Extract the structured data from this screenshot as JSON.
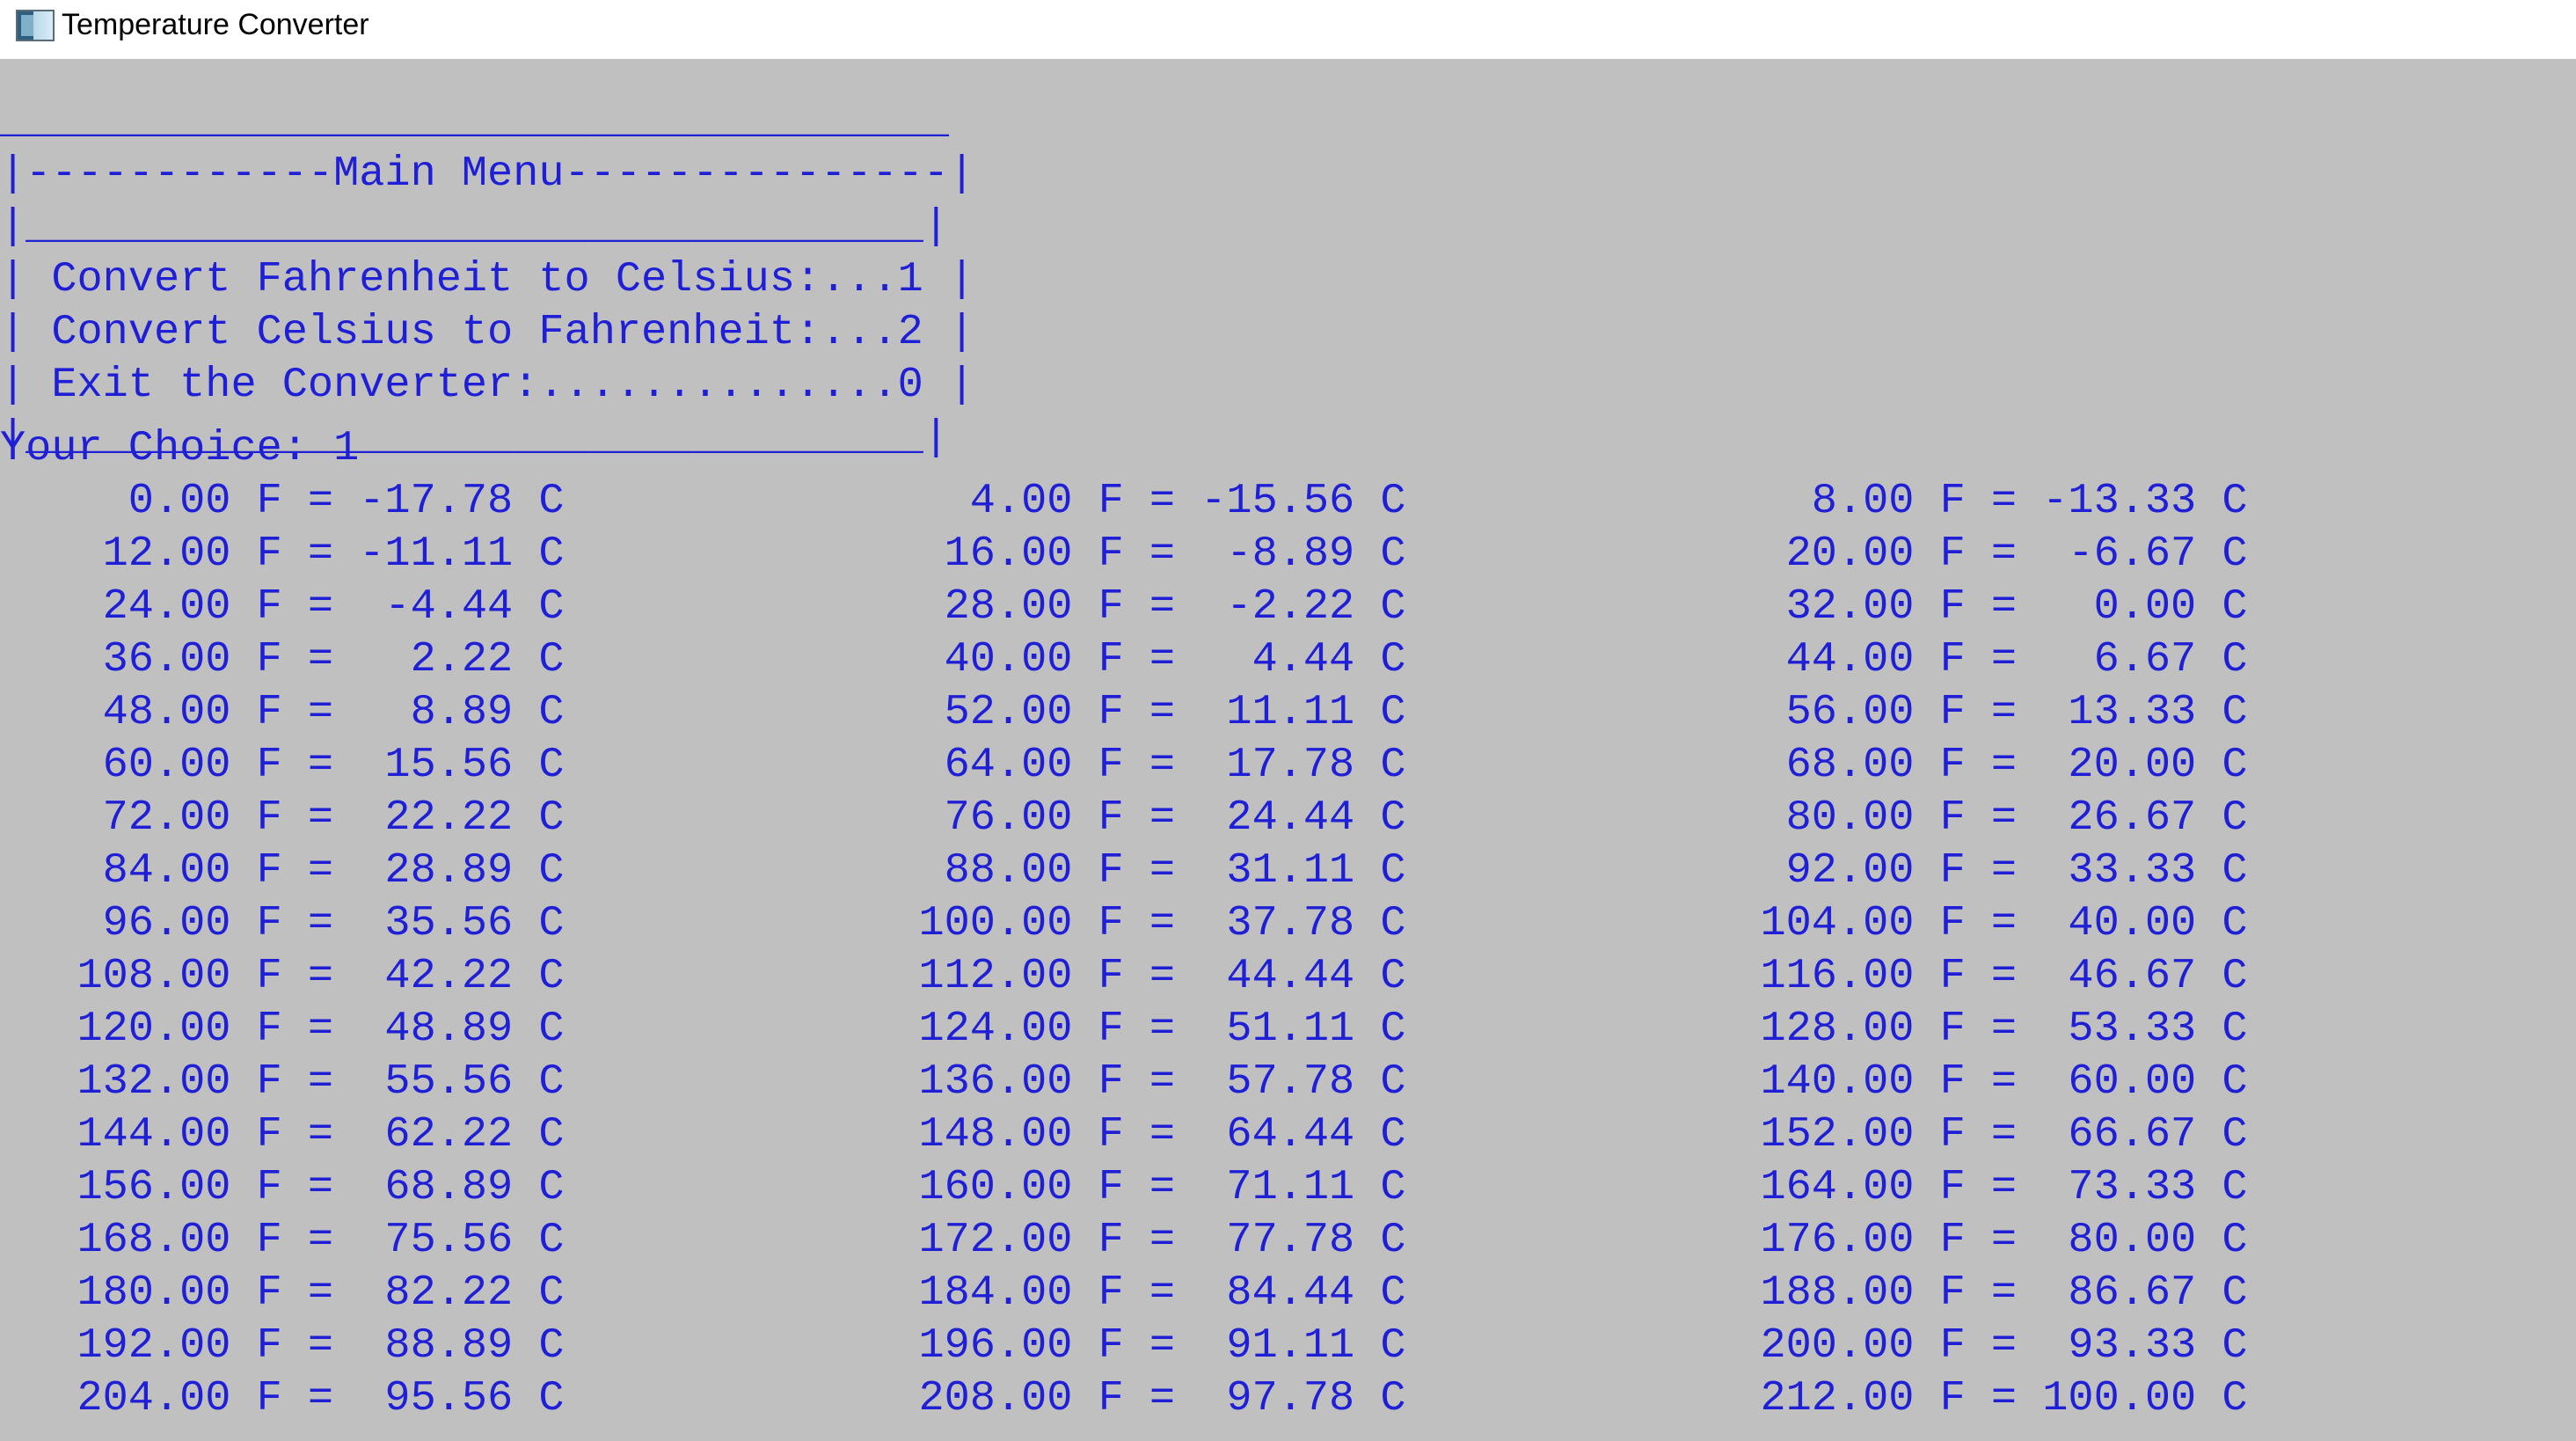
{
  "window": {
    "title": "Temperature Converter",
    "icon": "console-app-icon"
  },
  "colors": {
    "console_background": "#c0c0c0",
    "console_text": "#1f1fd6",
    "titlebar_background": "#ffffff"
  },
  "menu": {
    "lines": [
      "_____________________________________",
      "|------------Main Menu---------------|",
      "|___________________________________|",
      "| Convert Fahrenheit to Celsius:...1 |",
      "| Convert Celsius to Fahrenheit:...2 |",
      "| Exit the Converter:..............0 |",
      "|___________________________________|"
    ]
  },
  "prompt": {
    "text": "Your Choice: 1"
  },
  "table": {
    "rows": [
      [
        "     0.00 F = -17.78 C",
        "     4.00 F = -15.56 C",
        "     8.00 F = -13.33 C"
      ],
      [
        "    12.00 F = -11.11 C",
        "    16.00 F =  -8.89 C",
        "    20.00 F =  -6.67 C"
      ],
      [
        "    24.00 F =  -4.44 C",
        "    28.00 F =  -2.22 C",
        "    32.00 F =   0.00 C"
      ],
      [
        "    36.00 F =   2.22 C",
        "    40.00 F =   4.44 C",
        "    44.00 F =   6.67 C"
      ],
      [
        "    48.00 F =   8.89 C",
        "    52.00 F =  11.11 C",
        "    56.00 F =  13.33 C"
      ],
      [
        "    60.00 F =  15.56 C",
        "    64.00 F =  17.78 C",
        "    68.00 F =  20.00 C"
      ],
      [
        "    72.00 F =  22.22 C",
        "    76.00 F =  24.44 C",
        "    80.00 F =  26.67 C"
      ],
      [
        "    84.00 F =  28.89 C",
        "    88.00 F =  31.11 C",
        "    92.00 F =  33.33 C"
      ],
      [
        "    96.00 F =  35.56 C",
        "   100.00 F =  37.78 C",
        "   104.00 F =  40.00 C"
      ],
      [
        "   108.00 F =  42.22 C",
        "   112.00 F =  44.44 C",
        "   116.00 F =  46.67 C"
      ],
      [
        "   120.00 F =  48.89 C",
        "   124.00 F =  51.11 C",
        "   128.00 F =  53.33 C"
      ],
      [
        "   132.00 F =  55.56 C",
        "   136.00 F =  57.78 C",
        "   140.00 F =  60.00 C"
      ],
      [
        "   144.00 F =  62.22 C",
        "   148.00 F =  64.44 C",
        "   152.00 F =  66.67 C"
      ],
      [
        "   156.00 F =  68.89 C",
        "   160.00 F =  71.11 C",
        "   164.00 F =  73.33 C"
      ],
      [
        "   168.00 F =  75.56 C",
        "   172.00 F =  77.78 C",
        "   176.00 F =  80.00 C"
      ],
      [
        "   180.00 F =  82.22 C",
        "   184.00 F =  84.44 C",
        "   188.00 F =  86.67 C"
      ],
      [
        "   192.00 F =  88.89 C",
        "   196.00 F =  91.11 C",
        "   200.00 F =  93.33 C"
      ],
      [
        "   204.00 F =  95.56 C",
        "   208.00 F =  97.78 C",
        "   212.00 F = 100.00 C"
      ]
    ]
  }
}
